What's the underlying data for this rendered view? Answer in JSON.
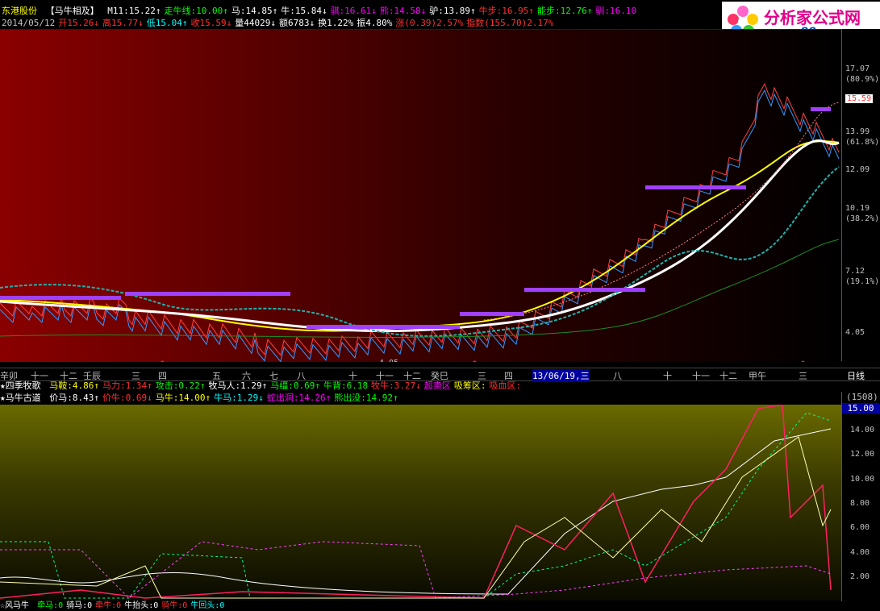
{
  "header": {
    "stock": "东港股份",
    "indicator": "【马牛相及】",
    "items": [
      {
        "text": "M11:15.22↑",
        "color": "#ffffff"
      },
      {
        "text": "走牛线:10.00↑",
        "color": "#00ff00"
      },
      {
        "text": "马:14.85↑",
        "color": "#ffffff"
      },
      {
        "text": "牛:15.84↓",
        "color": "#ffffff"
      },
      {
        "text": "骐:16.61↓",
        "color": "#ff00ff"
      },
      {
        "text": "熊:14.58↓",
        "color": "#ff00ff"
      },
      {
        "text": "驴:13.89↑",
        "color": "#ffffff"
      },
      {
        "text": "牛步:16.95↑",
        "color": "#ff3030"
      },
      {
        "text": "能步:12.76↑",
        "color": "#00ff00"
      },
      {
        "text": "驯:16.10",
        "color": "#ff00ff"
      }
    ],
    "line2": [
      {
        "text": "2014/05/12",
        "color": "#c0c0c0"
      },
      {
        "text": "开15.26↓",
        "color": "#ff3030"
      },
      {
        "text": "高15.77↓",
        "color": "#ff3030"
      },
      {
        "text": "低15.04↑",
        "color": "#00ffff"
      },
      {
        "text": "收15.59↓",
        "color": "#ff3030"
      },
      {
        "text": "量44029↓",
        "color": "#ffffff"
      },
      {
        "text": "额6783↓",
        "color": "#ffffff"
      },
      {
        "text": "换1.22%",
        "color": "#ffffff"
      },
      {
        "text": "振4.80%",
        "color": "#ffffff"
      },
      {
        "text": "涨(0.39)2.57%",
        "color": "#ff3030"
      },
      {
        "text": "指数(155.70)2.17%",
        "color": "#ff3030"
      }
    ]
  },
  "logo": {
    "name": "分析家公式网",
    "url": "www.88gs.com"
  },
  "price_axis": [
    {
      "label": "17.07",
      "color": "#c0c0c0"
    },
    {
      "label": "(80.9%)",
      "color": "#c0c0c0"
    },
    {
      "label": "15.59",
      "color": "#ff3030"
    },
    {
      "label": "13.99",
      "color": "#c0c0c0"
    },
    {
      "label": "(61.8%)",
      "color": "#c0c0c0"
    },
    {
      "label": "12.09",
      "color": "#c0c0c0"
    },
    {
      "label": "10.19",
      "color": "#c0c0c0"
    },
    {
      "label": "(38.2%)",
      "color": "#c0c0c0"
    },
    {
      "label": "7.12",
      "color": "#c0c0c0"
    },
    {
      "label": "(19.1%)",
      "color": "#c0c0c0"
    },
    {
      "label": "4.05",
      "color": "#c0c0c0"
    }
  ],
  "low_marker": "4.05",
  "date_labels": [
    "辛卯",
    "十一",
    "十二",
    "壬辰",
    "三",
    "四",
    "五",
    "六",
    "七",
    "八",
    "十",
    "十一",
    "十二",
    "癸巳",
    "三",
    "四",
    "13/06/19,三",
    "八",
    "十",
    "十一",
    "十二",
    "甲午",
    "三"
  ],
  "period_button": "日线",
  "row3": {
    "title": "★四季牧歌",
    "items": [
      {
        "text": "马鞍:4.86↑",
        "color": "#ffff00"
      },
      {
        "text": "马力:1.34↑",
        "color": "#ff3030"
      },
      {
        "text": "攻击:0.22↑",
        "color": "#00ff00"
      },
      {
        "text": "牧马人:1.29↑",
        "color": "#ffffff"
      },
      {
        "text": "马缰:0.69↑",
        "color": "#00ff00"
      },
      {
        "text": "牛背:6.18",
        "color": "#00ff00"
      },
      {
        "text": "牧牛:3.27↓",
        "color": "#ff3030"
      },
      {
        "text": "超卖区",
        "color": "#ff00ff"
      },
      {
        "text": "吸筹区:",
        "color": "#ffff00"
      },
      {
        "text": "吸血区:",
        "color": "#ff3030"
      }
    ]
  },
  "row4": {
    "title": "★马牛古道",
    "items": [
      {
        "text": "价马:8.43↑",
        "color": "#ffffff"
      },
      {
        "text": "价牛:0.69↓",
        "color": "#ff3030"
      },
      {
        "text": "马牛:14.00↑",
        "color": "#ffff00"
      },
      {
        "text": "牛马:1.29↓",
        "color": "#00ffff"
      },
      {
        "text": "蛇出洞:14.26↑",
        "color": "#ff00ff"
      },
      {
        "text": "熊出没:14.92↑",
        "color": "#00ff00"
      }
    ]
  },
  "ind_axis": {
    "top": "(1508)",
    "box": "15.00",
    "labels": [
      "14.00",
      "12.00",
      "10.00",
      "8.00",
      "6.00",
      "4.00",
      "2.00"
    ]
  },
  "bottom": {
    "title": "☆风马牛",
    "items": [
      {
        "text": "牵马:0",
        "color": "#00ff00"
      },
      {
        "text": "骑马:0",
        "color": "#ffffff"
      },
      {
        "text": "牵牛:0",
        "color": "#ff3030"
      },
      {
        "text": "牛抬头:0",
        "color": "#ffffff"
      },
      {
        "text": "骑牛:0",
        "color": "#ff3030"
      },
      {
        "text": "牛回头:0",
        "color": "#00ffff"
      }
    ]
  }
}
